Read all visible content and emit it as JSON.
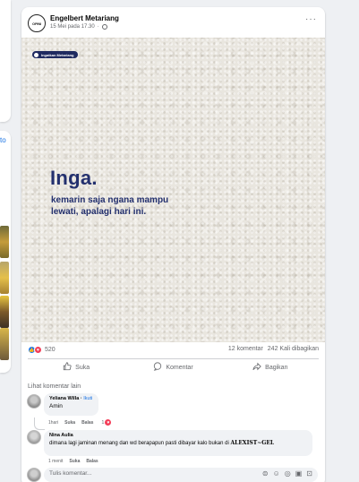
{
  "left_strip": {
    "text": "to"
  },
  "post": {
    "author": "Engelbert Metariang",
    "avatar_text": "OPINI",
    "date": "15 Mei pada 17.30",
    "more": "···",
    "image": {
      "brand": "Ingatkan Metariang",
      "headline": "Inga.",
      "line1": "kemarin saja ngana mampu",
      "line2": "lewati, apalagi hari ini."
    },
    "stats": {
      "reaction_count": "520",
      "comments": "12 komentar",
      "shares": "242 Kali dibagikan"
    },
    "actions": {
      "like": "Suka",
      "comment": "Komentar",
      "share": "Bagikan"
    },
    "see_more_comments": "Lihat komentar lain"
  },
  "comments": [
    {
      "name": "Yeliana Willa",
      "follow": "Ikuti",
      "text": "Amin",
      "time": "1hari",
      "like": "Suka",
      "reply": "Balas",
      "reaction_count": "1"
    },
    {
      "name": "Nina Aulia",
      "text_main": "dimana lagi jaminan menang dan wd berapapun pasti dibayar kalo bukan di",
      "text_brand": "ALEXIST~GEL",
      "time": "1 menit",
      "like": "Suka",
      "reply": "Balas"
    }
  ],
  "compose": {
    "placeholder": "Tulis komentar..."
  },
  "icons": {
    "like": "thumb-up-icon",
    "comment": "speech-bubble-icon",
    "share": "share-arrow-icon",
    "globe": "globe-icon",
    "compose": [
      "sticker-icon",
      "emoji-icon",
      "camera-icon",
      "gif-icon",
      "sticker-alt-icon"
    ]
  },
  "colors": {
    "accent": "#1877f2",
    "love": "#f33e58",
    "headline": "#23306e"
  }
}
